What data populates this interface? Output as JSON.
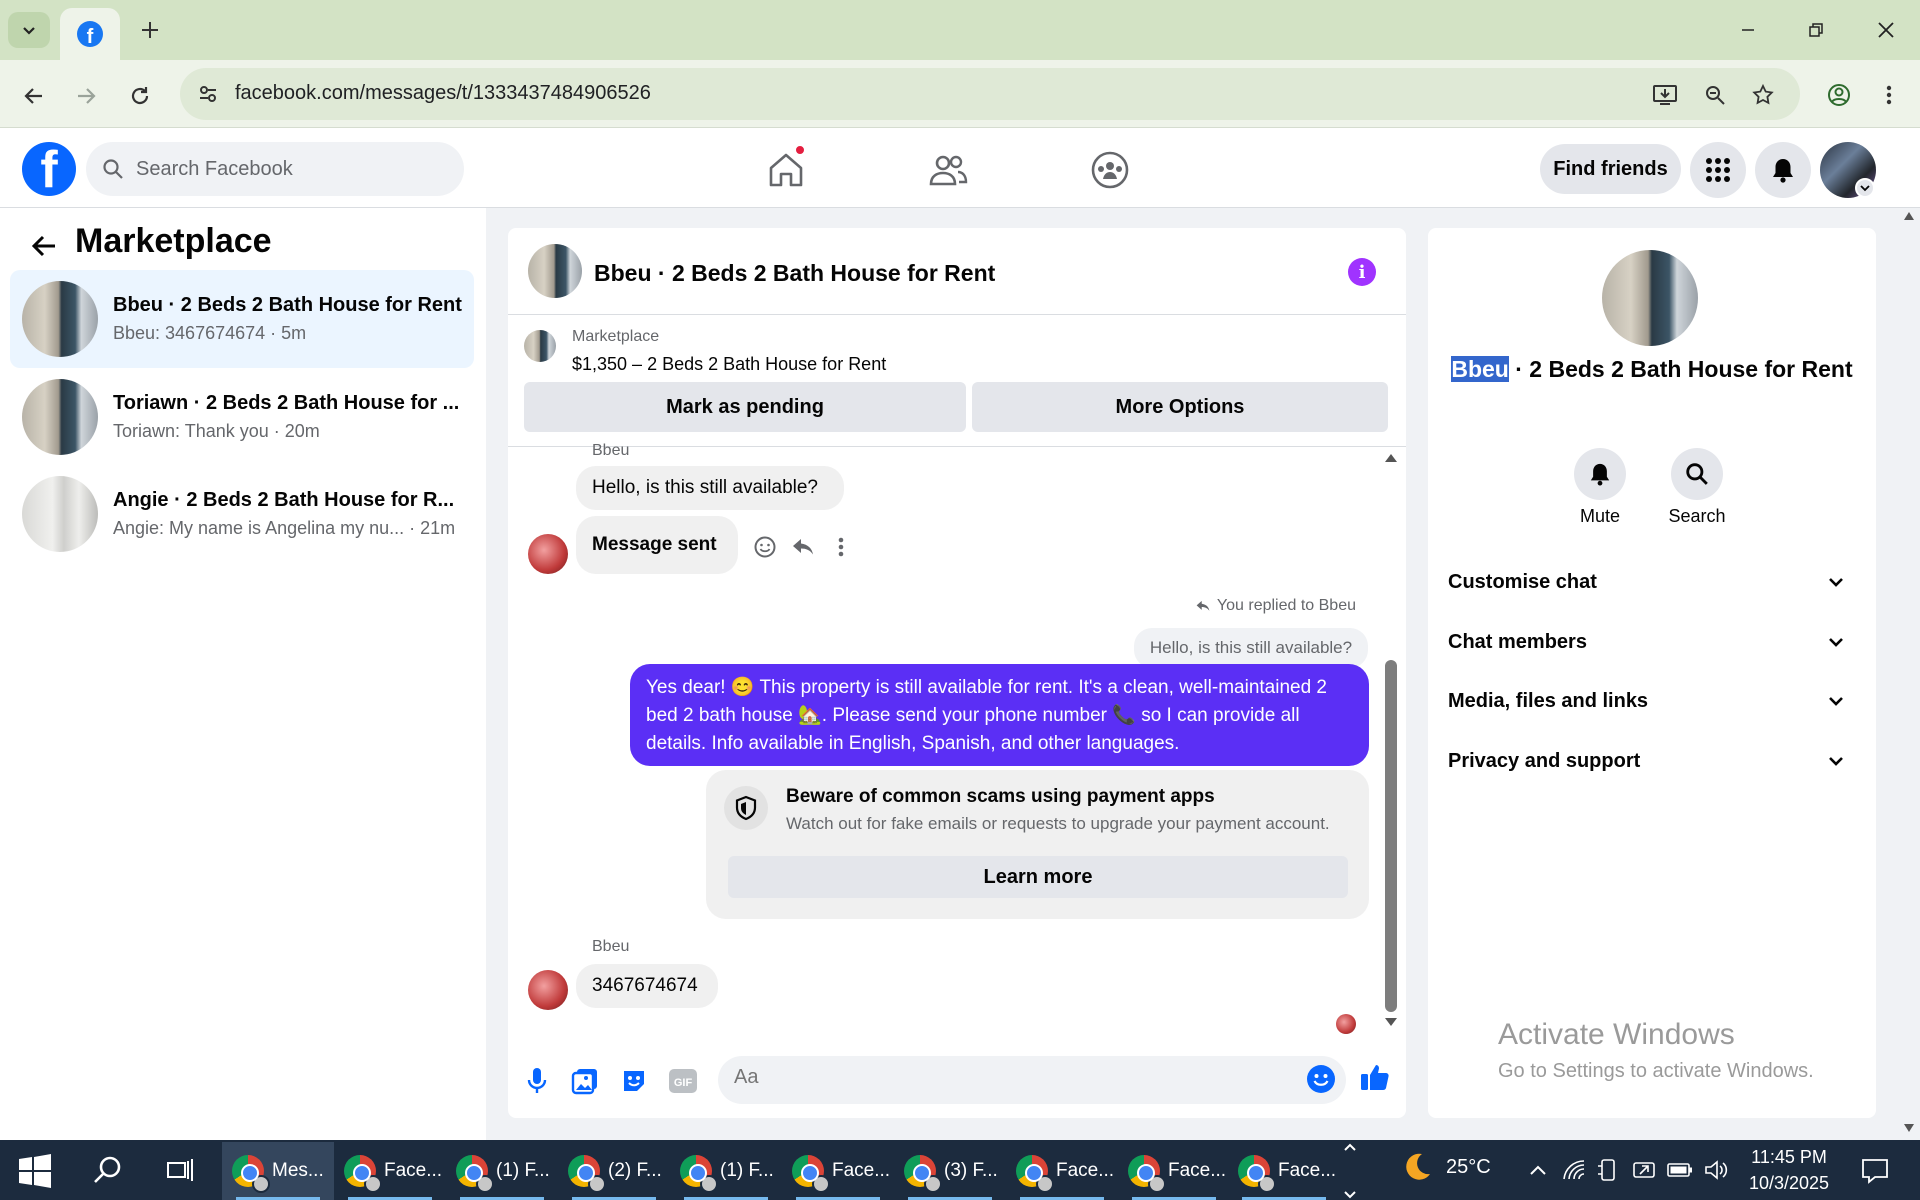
{
  "browser": {
    "url": "facebook.com/messages/t/1333437484906526",
    "tab_favicon": "facebook-icon"
  },
  "fb_header": {
    "search_placeholder": "Search Facebook",
    "find_friends_label": "Find friends",
    "nav_icons": [
      "home-icon",
      "friends-icon",
      "groups-icon"
    ],
    "notification_dot_color": "#e41e3f"
  },
  "sidebar": {
    "title": "Marketplace",
    "conversations": [
      {
        "name": "Bbeu · 2 Beds 2 Bath House for Rent",
        "snippet": "Bbeu: 3467674674 · 5m",
        "selected": true
      },
      {
        "name": "Toriawn · 2 Beds 2 Bath House for ...",
        "snippet": "Toriawn: Thank you · 20m",
        "selected": false
      },
      {
        "name": "Angie · 2 Beds 2 Bath House for R...",
        "snippet": "Angie: My name is Angelina my nu...  · 21m",
        "selected": false
      }
    ]
  },
  "chat": {
    "title": "Bbeu · 2 Beds 2 Bath House for Rent",
    "listing": {
      "label": "Marketplace",
      "price_title": "$1,350 – 2 Beds 2 Bath House for Rent",
      "mark_pending_label": "Mark as pending",
      "more_options_label": "More Options"
    },
    "messages": {
      "sender_1": "Bbeu",
      "in_1": "Hello, is this still available?",
      "in_2": "Message sent",
      "replied_note": "You replied to Bbeu",
      "replied_quote": "Hello, is this still available?",
      "out_1": "Yes dear! 😊 This property is still available for rent. It's a clean, well-maintained 2 bed 2 bath house 🏡. Please send your phone number 📞 so I can provide all details. Info available in English, Spanish, and other languages.",
      "scam_title": "Beware of common scams using payment apps",
      "scam_desc": "Watch out for fake emails or requests to upgrade your payment account.",
      "learn_more_label": "Learn more",
      "sender_2": "Bbeu",
      "in_3": "3467674674"
    },
    "composer_placeholder": "Aa",
    "accent_color": "#5b2ff5"
  },
  "details": {
    "title_highlighted": "Bbeu",
    "title_rest": " · 2 Beds 2 Bath House for Rent",
    "mute_label": "Mute",
    "search_label": "Search",
    "accordions": [
      "Customise chat",
      "Chat members",
      "Media, files and links",
      "Privacy and support"
    ]
  },
  "watermark": {
    "title": "Activate Windows",
    "subtitle": "Go to Settings to activate Windows."
  },
  "taskbar": {
    "items": [
      "Mes...",
      "Face...",
      "(1) F...",
      "(2) F...",
      "(1) F...",
      "Face...",
      "(3) F...",
      "Face...",
      "Face...",
      "Face..."
    ],
    "temperature": "25°C",
    "time": "11:45 PM",
    "date": "10/3/2025"
  }
}
